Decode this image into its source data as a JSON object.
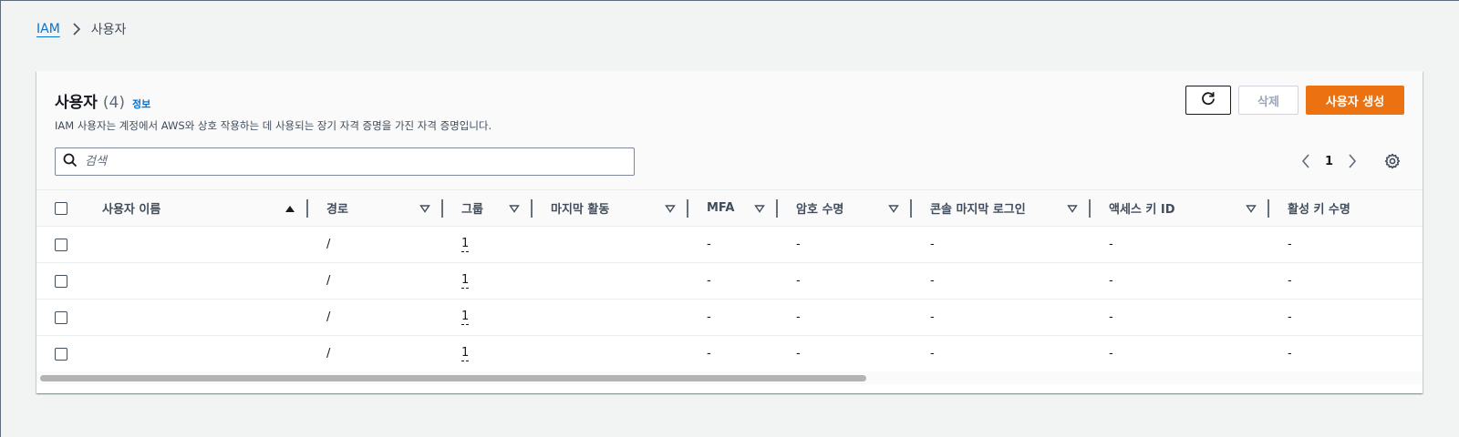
{
  "breadcrumb": {
    "root": "IAM",
    "current": "사용자"
  },
  "header": {
    "title": "사용자",
    "count": "(4)",
    "info": "정보",
    "description": "IAM 사용자는 계정에서 AWS와 상호 작용하는 데 사용되는 장기 자격 증명을 가진 자격 증명입니다."
  },
  "actions": {
    "delete_label": "삭제",
    "create_label": "사용자 생성"
  },
  "search": {
    "placeholder": "검색",
    "value": ""
  },
  "pagination": {
    "current_page": "1"
  },
  "table": {
    "columns": [
      "사용자 이름",
      "경로",
      "그룹",
      "마지막 활동",
      "MFA",
      "암호 수명",
      "콘솔 마지막 로그인",
      "액세스 키 ID",
      "활성 키 수명"
    ],
    "rows": [
      {
        "user_name": "",
        "path": "/",
        "groups": "1",
        "last_activity": "",
        "mfa": "-",
        "password_age": "-",
        "console_last_signin": "-",
        "access_key_id": "-",
        "active_key_age": "-"
      },
      {
        "user_name": "",
        "path": "/",
        "groups": "1",
        "last_activity": "",
        "mfa": "-",
        "password_age": "-",
        "console_last_signin": "-",
        "access_key_id": "-",
        "active_key_age": "-"
      },
      {
        "user_name": "",
        "path": "/",
        "groups": "1",
        "last_activity": "",
        "mfa": "-",
        "password_age": "-",
        "console_last_signin": "-",
        "access_key_id": "-",
        "active_key_age": "-"
      },
      {
        "user_name": "",
        "path": "/",
        "groups": "1",
        "last_activity": "",
        "mfa": "-",
        "password_age": "-",
        "console_last_signin": "-",
        "access_key_id": "-",
        "active_key_age": "-"
      }
    ]
  },
  "icons": {
    "breadcrumb_separator": "chevron-right-icon",
    "refresh": "refresh-icon",
    "search": "search-icon",
    "prev": "chevron-left-icon",
    "next": "chevron-right-icon",
    "settings": "gear-icon",
    "sort_ascending": "caret-up-filled-icon",
    "sort": "caret-down-outline-icon"
  },
  "colors": {
    "primary": "#ec7211",
    "link": "#0972d3",
    "background": "#f2f3f3"
  }
}
